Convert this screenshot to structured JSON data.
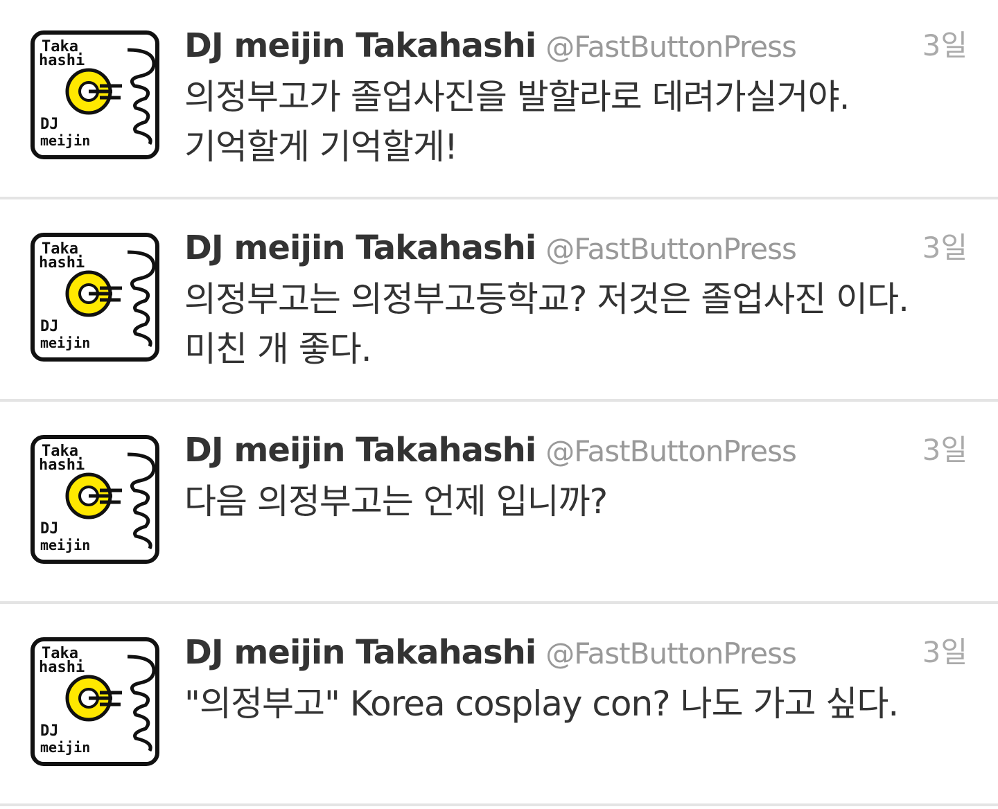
{
  "colors": {
    "name": "#333333",
    "handle": "#999999",
    "timestamp": "#aaaaaa",
    "divider": "#e4e4e4",
    "avatar_circle": "#ffe800"
  },
  "avatar_logo": {
    "line1": "Taka",
    "line2": "hashi",
    "line3": "DJ",
    "line4": "meijin",
    "icon": "dj-meijin-takahashi-logo-icon"
  },
  "tweets": [
    {
      "name": "DJ meijin Takahashi",
      "handle": "@FastButtonPress",
      "time": "3일",
      "text": "의정부고가 졸업사진을 발할라로 데려가실거야. 기억할게 기억할게!"
    },
    {
      "name": "DJ meijin Takahashi",
      "handle": "@FastButtonPress",
      "time": "3일",
      "text": "의정부고는 의정부고등학교? 저것은 졸업사진 이다. 미친 개 좋다."
    },
    {
      "name": "DJ meijin Takahashi",
      "handle": "@FastButtonPress",
      "time": "3일",
      "text": "다음 의정부고는 언제 입니까?"
    },
    {
      "name": "DJ meijin Takahashi",
      "handle": "@FastButtonPress",
      "time": "3일",
      "text": "\"의정부고\" Korea cosplay con? 나도 가고 싶다."
    }
  ]
}
